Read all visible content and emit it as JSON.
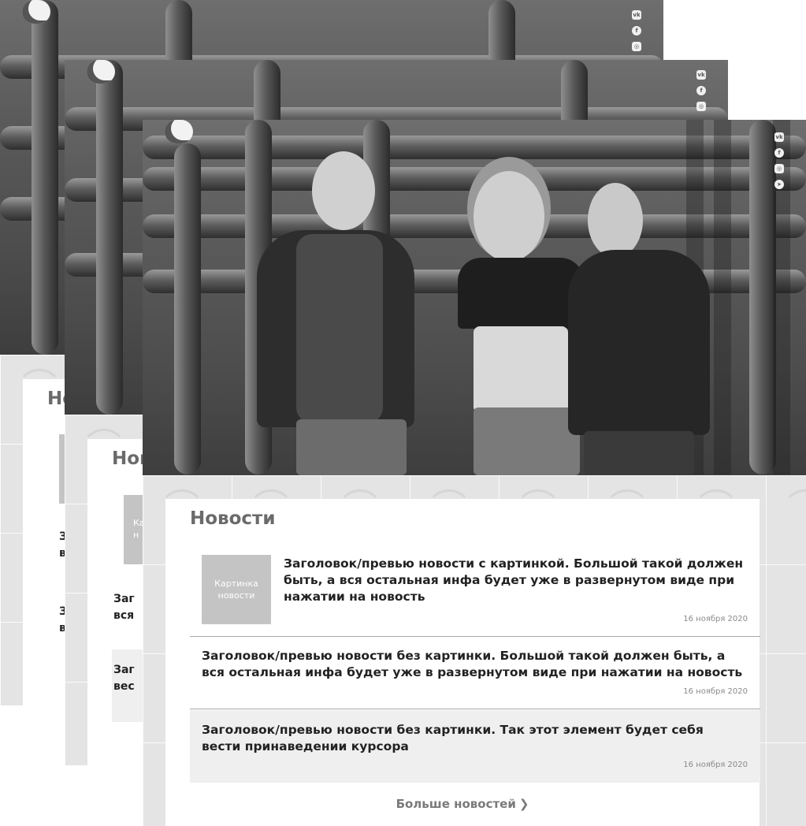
{
  "social": {
    "vk": "vk",
    "facebook": "f",
    "instagram": "◎",
    "telegram": "➤"
  },
  "icons": [
    "logo-icon",
    "vk-icon",
    "facebook-icon",
    "instagram-icon",
    "telegram-icon",
    "chevron-right-icon",
    "leaf-pattern-icon"
  ],
  "news": {
    "heading": "Новости",
    "items": [
      {
        "thumb": "Картинка новости",
        "title": "Заголовок/превью новости с картинкой. Большой такой должен быть, а вся остальная инфа будет уже в развернутом виде при нажатии на новость",
        "date": "16 ноября 2020"
      },
      {
        "title": "Заголовок/превью новости без картинки. Большой такой должен быть, а вся остальная инфа будет уже в развернутом виде при нажатии на новость",
        "date": "16 ноября 2020"
      },
      {
        "title": "Заголовок/превью новости без картинки. Так этот элемент будет себя вести принаведении курсора",
        "date": "16 ноября 2020"
      }
    ],
    "more": "Больше новостей"
  },
  "back_layers": {
    "layer1_heading": "Но",
    "layer2_heading": "Нов",
    "layer1_lines": [
      "З",
      "в",
      "З",
      "в"
    ],
    "layer2_thumb": "Ка н",
    "layer2_lines": [
      "Заг",
      "вся",
      "Заг",
      "вес"
    ]
  },
  "colors": {
    "card": "#ffffff",
    "hover": "#efefef",
    "thumb": "#c4c4c4",
    "band": "#e4e4e4"
  }
}
